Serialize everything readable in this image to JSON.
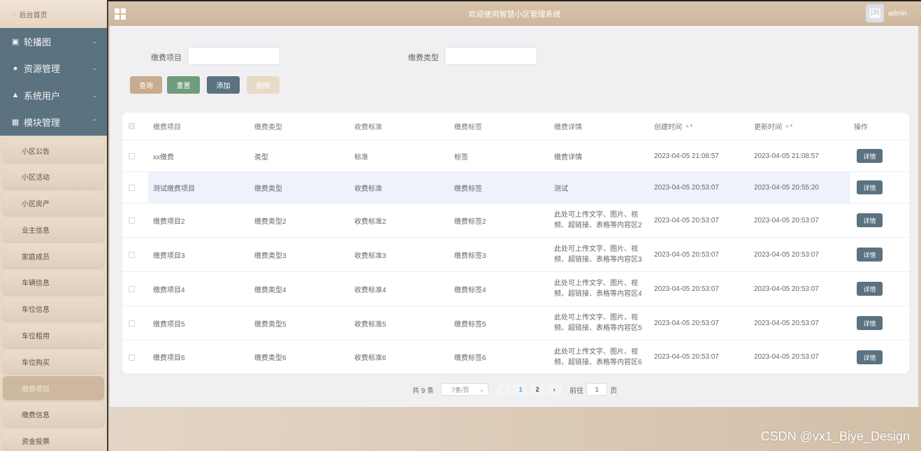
{
  "sidebar": {
    "home_label": "后台首页",
    "menus": [
      {
        "label": "轮播图",
        "icon": "image-icon"
      },
      {
        "label": "资源管理",
        "icon": "bulb-icon"
      },
      {
        "label": "系统用户",
        "icon": "user-icon"
      },
      {
        "label": "模块管理",
        "icon": "grid-icon"
      }
    ],
    "sub_items": [
      "小区公告",
      "小区活动",
      "小区房产",
      "业主信息",
      "家庭成员",
      "车辆信息",
      "车位信息",
      "车位租用",
      "车位购买",
      "缴费项目",
      "缴费信息",
      "资金投票"
    ],
    "active_sub": "缴费项目"
  },
  "header": {
    "title": "欢迎使用智慧小区管理系统",
    "user": "admin"
  },
  "search": {
    "field1_label": "缴费项目",
    "field1_value": "",
    "field2_label": "缴费类型",
    "field2_value": ""
  },
  "buttons": {
    "query": "查询",
    "reset": "重置",
    "add": "添加",
    "delete": "删除"
  },
  "table": {
    "columns": [
      "缴费项目",
      "缴费类型",
      "收费标准",
      "缴费标签",
      "缴费详情",
      "创建时间",
      "更新时间",
      "操作"
    ],
    "detail_label": "详情",
    "rows": [
      {
        "item": "xx缴费",
        "type": "类型",
        "standard": "标准",
        "tag": "标签",
        "detail": [
          "缴费详情"
        ],
        "created": "2023-04-05 21:08:57",
        "updated": "2023-04-05 21:08:57"
      },
      {
        "item": "测试缴费项目",
        "type": "缴费类型",
        "standard": "收费标准",
        "tag": "缴费标签",
        "detail": [
          "测试"
        ],
        "created": "2023-04-05 20:53:07",
        "updated": "2023-04-05 20:55:20"
      },
      {
        "item": "缴费项目2",
        "type": "缴费类型2",
        "standard": "收费标准2",
        "tag": "缴费标签2",
        "detail": [
          "此处可上传文字、图片、视",
          "频、超链接、表格等内容区2"
        ],
        "created": "2023-04-05 20:53:07",
        "updated": "2023-04-05 20:53:07"
      },
      {
        "item": "缴费项目3",
        "type": "缴费类型3",
        "standard": "收费标准3",
        "tag": "缴费标签3",
        "detail": [
          "此处可上传文字、图片、视",
          "频、超链接、表格等内容区3"
        ],
        "created": "2023-04-05 20:53:07",
        "updated": "2023-04-05 20:53:07"
      },
      {
        "item": "缴费项目4",
        "type": "缴费类型4",
        "standard": "收费标准4",
        "tag": "缴费标签4",
        "detail": [
          "此处可上传文字、图片、视",
          "频、超链接、表格等内容区4"
        ],
        "created": "2023-04-05 20:53:07",
        "updated": "2023-04-05 20:53:07"
      },
      {
        "item": "缴费项目5",
        "type": "缴费类型5",
        "standard": "收费标准5",
        "tag": "缴费标签5",
        "detail": [
          "此处可上传文字、图片、视",
          "频、超链接、表格等内容区5"
        ],
        "created": "2023-04-05 20:53:07",
        "updated": "2023-04-05 20:53:07"
      },
      {
        "item": "缴费项目6",
        "type": "缴费类型6",
        "standard": "收费标准6",
        "tag": "缴费标签6",
        "detail": [
          "此处可上传文字、图片、视",
          "频、超链接、表格等内容区6"
        ],
        "created": "2023-04-05 20:53:07",
        "updated": "2023-04-05 20:53:07"
      }
    ]
  },
  "pagination": {
    "total": "共 9 条",
    "page_size": "7条/页",
    "pages": [
      "1",
      "2"
    ],
    "current": "1",
    "goto_label": "前往",
    "goto_value": "1",
    "page_suffix": "页"
  },
  "watermark": "CSDN @vx1_Biye_Design"
}
